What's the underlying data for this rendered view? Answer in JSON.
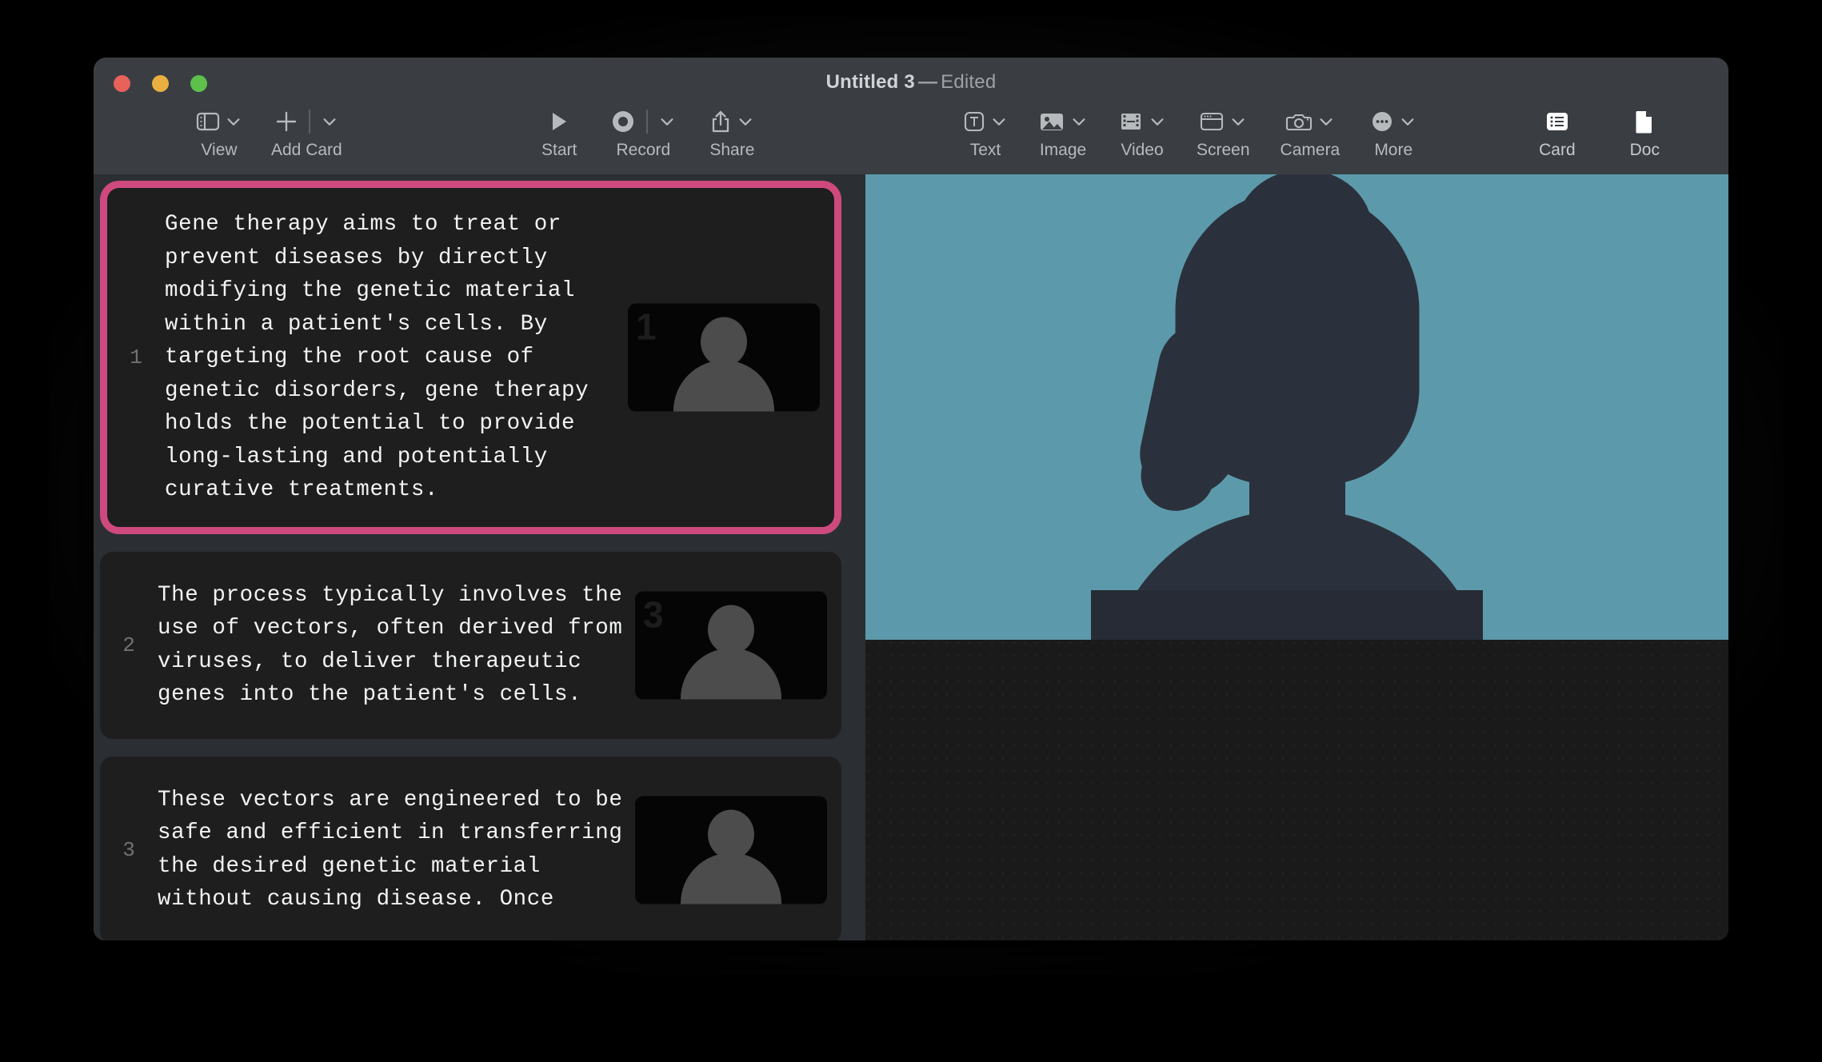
{
  "window": {
    "title": "Untitled 3",
    "title_separator": "—",
    "edited_badge": "Edited",
    "traffic_lights": [
      "close",
      "minimize",
      "zoom"
    ],
    "colors": {
      "close": "#e8615a",
      "minimize": "#e9b03f",
      "zoom": "#5cc04a",
      "chrome_bg": "#3a3e42",
      "cards_pane_bg": "#2b2f33",
      "card_bg": "#1e1e1e",
      "selection_pink": "#ce4a7e",
      "preview_teal": "#5c9aab",
      "silhouette": "#2b313c"
    }
  },
  "toolbar": {
    "groups": [
      {
        "name": "left",
        "items": [
          {
            "label": "View",
            "icon": "sidebar-icon",
            "has_chevron": true,
            "has_separator": false
          },
          {
            "label": "Add Card",
            "icon": "plus-icon",
            "has_chevron": true,
            "has_separator": true
          }
        ]
      },
      {
        "name": "playback",
        "items": [
          {
            "label": "Start",
            "icon": "play-icon",
            "has_chevron": false,
            "has_separator": false
          },
          {
            "label": "Record",
            "icon": "record-icon",
            "has_chevron": true,
            "has_separator": true
          },
          {
            "label": "Share",
            "icon": "share-icon",
            "has_chevron": true,
            "has_separator": false
          }
        ]
      },
      {
        "name": "insert",
        "items": [
          {
            "label": "Text",
            "icon": "text-box-icon",
            "has_chevron": true,
            "has_separator": false
          },
          {
            "label": "Image",
            "icon": "image-icon",
            "has_chevron": true,
            "has_separator": false
          },
          {
            "label": "Video",
            "icon": "film-icon",
            "has_chevron": true,
            "has_separator": false
          },
          {
            "label": "Screen",
            "icon": "window-icon",
            "has_chevron": true,
            "has_separator": false
          },
          {
            "label": "Camera",
            "icon": "camera-icon",
            "has_chevron": true,
            "has_separator": false
          },
          {
            "label": "More",
            "icon": "ellipsis-circle-icon",
            "has_chevron": true,
            "has_separator": false
          }
        ]
      },
      {
        "name": "view-mode",
        "items": [
          {
            "label": "Card",
            "icon": "card-list-icon",
            "has_chevron": false,
            "has_separator": false,
            "selected": true
          },
          {
            "label": "Doc",
            "icon": "document-icon",
            "has_chevron": false,
            "has_separator": false,
            "selected": false
          }
        ]
      }
    ]
  },
  "cards": [
    {
      "index": "1",
      "text": "Gene therapy aims to treat or\nprevent diseases by directly\nmodifying the genetic material\nwithin a patient's cells. By\ntargeting the root cause of\ngenetic disorders, gene therapy\nholds the potential to provide\nlong‑lasting and potentially\ncurative treatments.",
      "selected": true,
      "thumbnail": {
        "badge": "1",
        "kind": "person-avatar"
      }
    },
    {
      "index": "2",
      "text": "The process typically involves the\nuse of vectors, often derived from\nviruses, to deliver therapeutic\ngenes into the patient's cells.",
      "selected": false,
      "thumbnail": {
        "badge": "3",
        "kind": "person-avatar"
      }
    },
    {
      "index": "3",
      "text": "These vectors are engineered to be\nsafe and efficient in transferring\nthe desired genetic material\nwithout causing disease. Once",
      "selected": false,
      "thumbnail": {
        "badge": "",
        "kind": "person-avatar"
      }
    }
  ],
  "preview": {
    "kind": "video-avatar-placeholder",
    "background_color": "#5c9aab",
    "subject": "female-silhouette"
  }
}
